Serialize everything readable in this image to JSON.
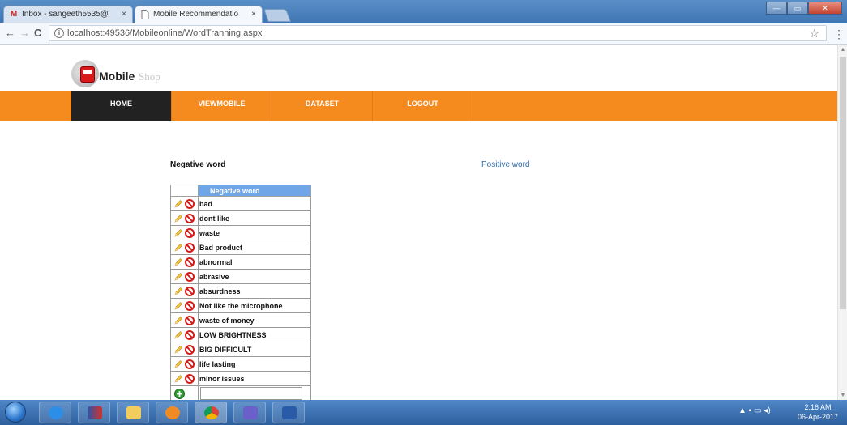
{
  "browser": {
    "tabs": [
      {
        "label": "Inbox - sangeeth5535@",
        "icon": "gmail-icon",
        "active": false
      },
      {
        "label": "Mobile Recommendatio",
        "icon": "page-icon",
        "active": true
      }
    ],
    "tab_close": "×",
    "url": "localhost:49536/Mobileonline/WordTranning.aspx",
    "nav": {
      "back": "←",
      "forward": "→",
      "reload": "C"
    },
    "info": "i",
    "star": "☆",
    "menu": "⋮"
  },
  "site": {
    "logo": {
      "brand_bold": "Mobile",
      "brand_light": "Shop"
    },
    "menu": [
      {
        "label": "HOME",
        "active": true
      },
      {
        "label": "VIEWMOBILE",
        "active": false
      },
      {
        "label": "DATASET",
        "active": false
      },
      {
        "label": "LOGOUT",
        "active": false
      }
    ],
    "accent_color": "#f58a1f",
    "active_menu_color": "#222222"
  },
  "content": {
    "negative_title": "Negative word",
    "positive_title": "Positive word",
    "grid": {
      "header": "Negative word",
      "header_color": "#6ea6e8",
      "rows": [
        "bad",
        "dont like",
        "waste",
        "Bad product",
        "abnormal",
        "abrasive",
        "absurdness",
        "Not like the microphone",
        "waste of money",
        "LOW BRIGHTNESS",
        "BIG DIFFICULT",
        "life lasting",
        "minor issues"
      ],
      "row_icons": [
        "pencil-icon",
        "delete-icon"
      ],
      "footer_icon": "add-icon",
      "new_word_value": ""
    }
  },
  "taskbar": {
    "time": "2:16 AM",
    "date": "06-Apr-2017",
    "tray": "▲ ▪ ▭ ◂)"
  }
}
